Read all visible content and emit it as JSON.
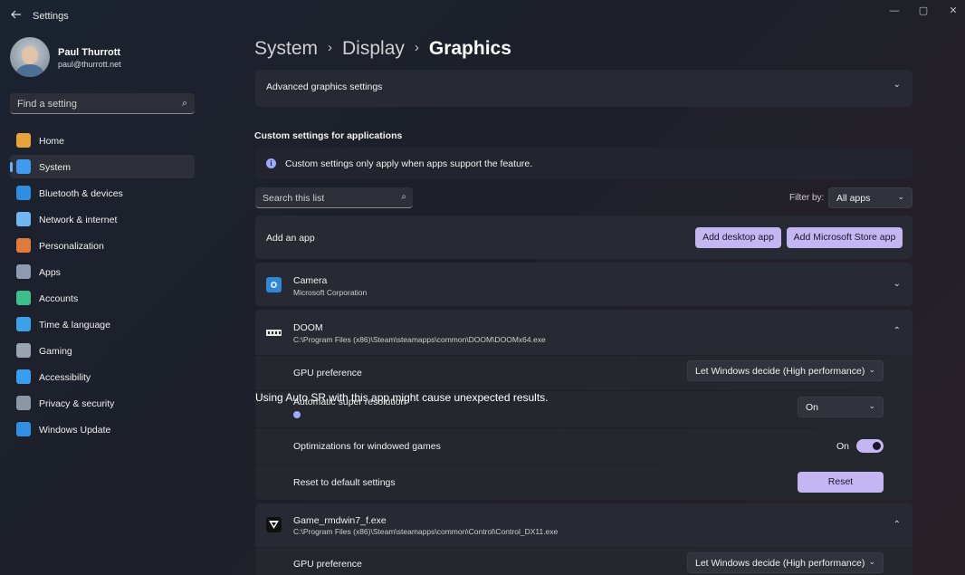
{
  "window": {
    "app_title": "Settings",
    "back_icon": "arrow-left-icon",
    "controls": {
      "minimize": "—",
      "maximize": "▢",
      "close": "✕"
    }
  },
  "user": {
    "name": "Paul Thurrott",
    "email": "paul@thurrott.net"
  },
  "sidebar": {
    "search_placeholder": "Find a setting",
    "search_icon": "⌕",
    "items": [
      {
        "label": "Home",
        "icon": "home-icon",
        "color": "#e8a33c",
        "active": false
      },
      {
        "label": "System",
        "icon": "system-display-icon",
        "color": "#3f9bef",
        "active": true
      },
      {
        "label": "Bluetooth & devices",
        "icon": "bluetooth-icon",
        "color": "#2d8de0",
        "active": false
      },
      {
        "label": "Network & internet",
        "icon": "wifi-icon",
        "color": "#6fb7f0",
        "active": false
      },
      {
        "label": "Personalization",
        "icon": "brush-icon",
        "color": "#e07a3a",
        "active": false
      },
      {
        "label": "Apps",
        "icon": "apps-icon",
        "color": "#8e9bb0",
        "active": false
      },
      {
        "label": "Accounts",
        "icon": "person-icon",
        "color": "#3cc08b",
        "active": false
      },
      {
        "label": "Time & language",
        "icon": "globe-clock-icon",
        "color": "#3aa3e8",
        "active": false
      },
      {
        "label": "Gaming",
        "icon": "gamepad-icon",
        "color": "#9aa3b0",
        "active": false
      },
      {
        "label": "Accessibility",
        "icon": "accessibility-icon",
        "color": "#3a9ef0",
        "active": false
      },
      {
        "label": "Privacy & security",
        "icon": "shield-icon",
        "color": "#8c96a6",
        "active": false
      },
      {
        "label": "Windows Update",
        "icon": "refresh-icon",
        "color": "#2f8fe5",
        "active": false
      }
    ]
  },
  "breadcrumb": {
    "items": [
      "System",
      "Display"
    ],
    "current": "Graphics",
    "separator": "›"
  },
  "advanced": {
    "label": "Advanced graphics settings",
    "chevron": "⌄"
  },
  "custom": {
    "heading": "Custom settings for applications",
    "info_text": "Custom settings only apply when apps support the feature.",
    "info_icon": "i"
  },
  "list_search": {
    "placeholder": "Search this list",
    "icon": "⌕"
  },
  "filter": {
    "label": "Filter by:",
    "value": "All apps",
    "chevron": "⌄"
  },
  "add_app": {
    "label": "Add an app",
    "desktop_button": "Add desktop app",
    "store_button": "Add Microsoft Store app"
  },
  "apps": {
    "camera": {
      "name": "Camera",
      "publisher": "Microsoft Corporation",
      "chevron": "⌄"
    },
    "doom": {
      "name": "DOOM",
      "path": "C:\\Program Files (x86)\\Steam\\steamapps\\common\\DOOM\\DOOMx64.exe",
      "chevron": "⌃",
      "gpu_label": "GPU preference",
      "gpu_value": "Let Windows decide (High performance)",
      "autosr_label": "Automatic super resolution",
      "autosr_note": "Using Auto SR with this app might cause unexpected results.",
      "autosr_value": "On",
      "windowed_label": "Optimizations for windowed games",
      "windowed_state": "On",
      "reset_label": "Reset to default settings",
      "reset_button": "Reset"
    },
    "game2": {
      "name": "Game_rmdwin7_f.exe",
      "path": "C:\\Program Files (x86)\\Steam\\steamapps\\common\\Control\\Control_DX11.exe",
      "chevron": "⌃",
      "gpu_label": "GPU preference",
      "gpu_value": "Let Windows decide (High performance)"
    }
  }
}
